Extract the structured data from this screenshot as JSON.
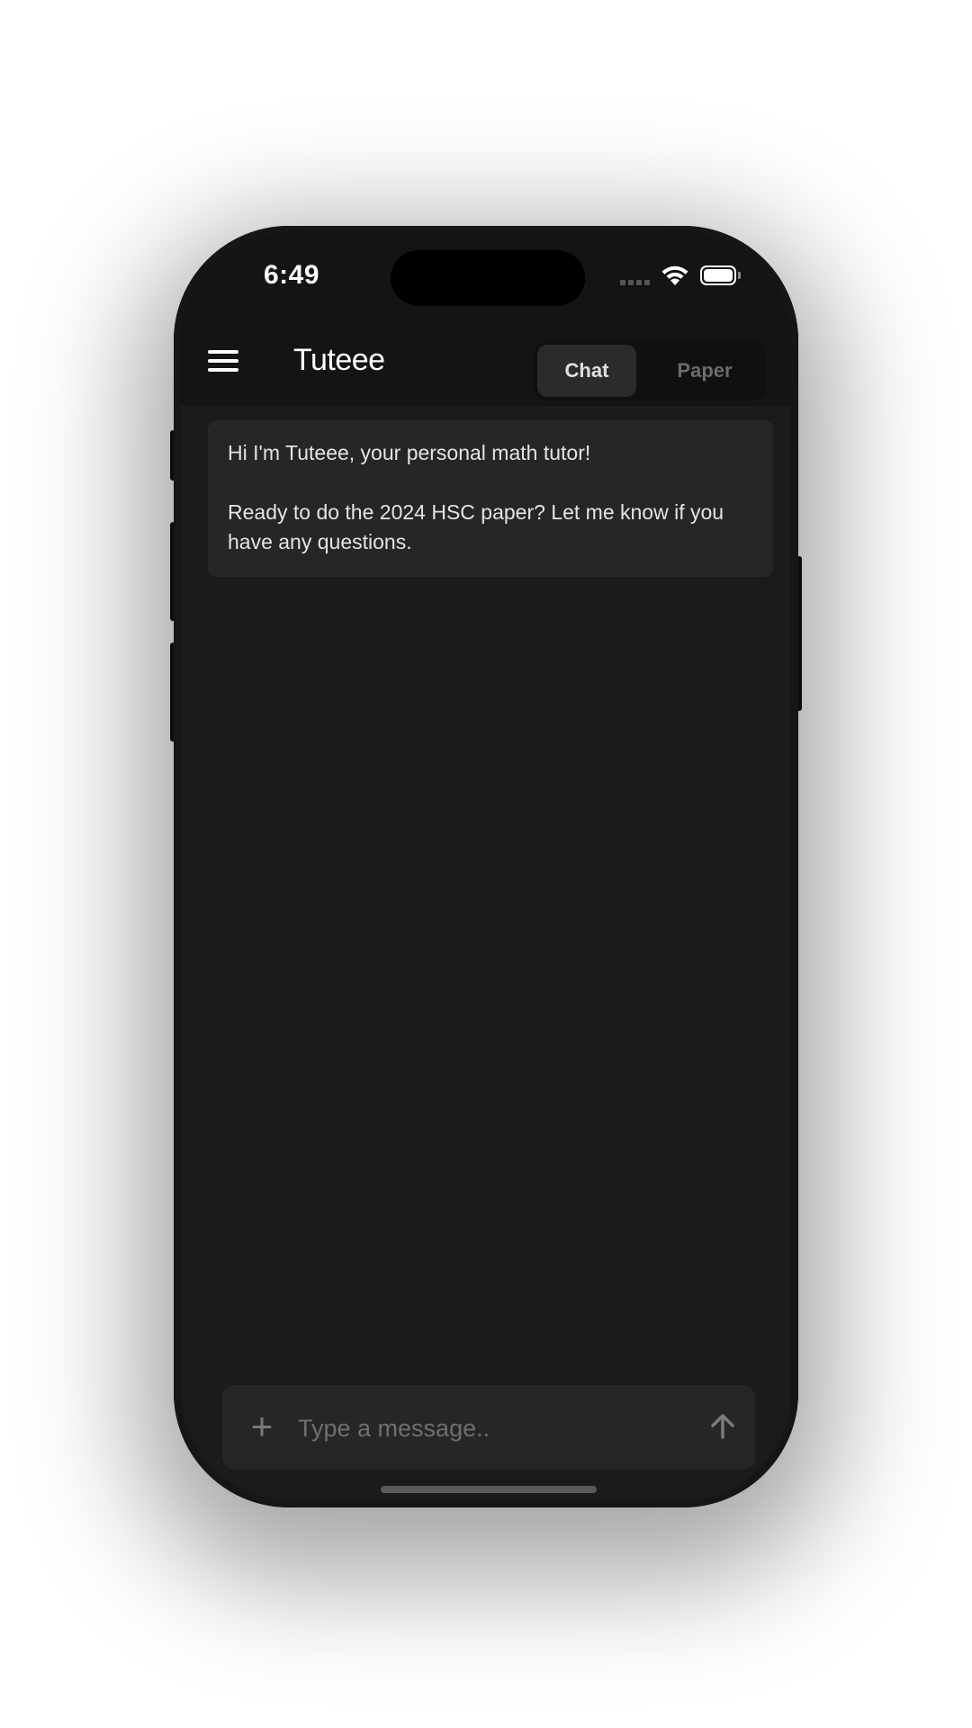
{
  "status_bar": {
    "time": "6:49"
  },
  "header": {
    "title": "Tuteee",
    "tabs": [
      {
        "label": "Chat",
        "active": true
      },
      {
        "label": "Paper",
        "active": false
      }
    ]
  },
  "chat": {
    "messages": [
      {
        "sender": "assistant",
        "line1": "Hi I'm Tuteee, your personal math tutor!",
        "line2": "Ready to do the 2024 HSC paper? Let me know if you have any questions."
      }
    ]
  },
  "composer": {
    "placeholder": "Type a message..",
    "value": ""
  },
  "icons": {
    "menu": "hamburger-menu-icon",
    "attach": "plus-icon",
    "send": "arrow-up-icon",
    "wifi": "wifi-icon",
    "battery": "battery-icon",
    "signal": "cellular-signal-icon"
  },
  "colors": {
    "background": "#1b1b1b",
    "header": "#141414",
    "bubble": "#262626",
    "active_tab": "#2b2b2b",
    "text": "#e4e4e4",
    "muted": "#6b6b6b"
  }
}
